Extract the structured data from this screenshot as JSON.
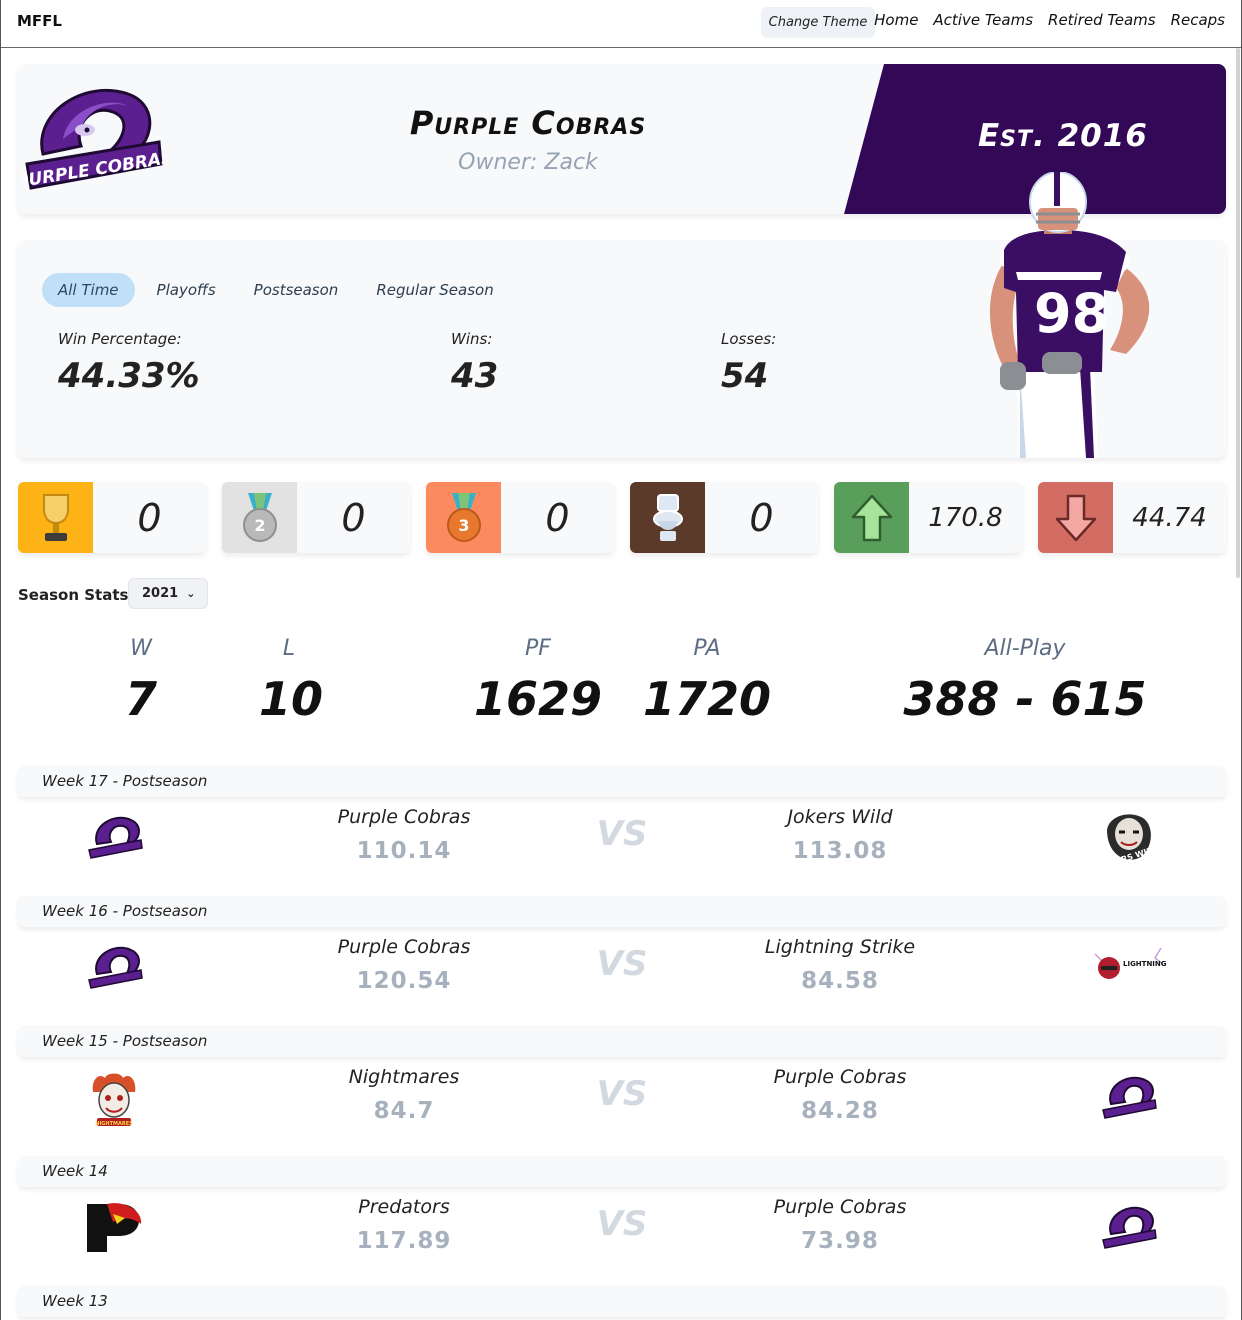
{
  "nav": {
    "brand": "MFFL",
    "theme_button": "Change Theme",
    "links": [
      "Home",
      "Active Teams",
      "Retired Teams",
      "Recaps"
    ]
  },
  "team": {
    "name": "Purple Cobras",
    "owner": "Owner: Zack",
    "established": "Est. 2016",
    "logo_text": "PURPLE COBRAS",
    "primary_color": "#330856",
    "jersey_number": "98"
  },
  "record_tabs": [
    "All Time",
    "Playoffs",
    "Postseason",
    "Regular Season"
  ],
  "record": {
    "win_pct_label": "Win Percentage:",
    "win_pct": "44.33%",
    "wins_label": "Wins:",
    "wins": "43",
    "losses_label": "Losses:",
    "losses": "54"
  },
  "awards": [
    {
      "icon": "trophy-icon",
      "value": "0",
      "color": "#fdb216"
    },
    {
      "icon": "silver-medal-icon",
      "value": "0",
      "color": "#e2e2e2"
    },
    {
      "icon": "bronze-medal-icon",
      "value": "0",
      "color": "#fb8a5e"
    },
    {
      "icon": "toilet-icon",
      "value": "0",
      "color": "#5b3a2a"
    },
    {
      "icon": "arrow-up-icon",
      "value": "170.8",
      "color": "#5a9e5b"
    },
    {
      "icon": "arrow-down-icon",
      "value": "44.74",
      "color": "#d36d63"
    }
  ],
  "season": {
    "label": "Season Stats:",
    "selected": "2021",
    "headers": {
      "w": "W",
      "l": "L",
      "pf": "PF",
      "pa": "PA",
      "allplay": "All-Play"
    },
    "values": {
      "w": "7",
      "l": "10",
      "pf": "1629",
      "pa": "1720",
      "allplay": "388 - 615"
    }
  },
  "vs_text": "VS",
  "games": [
    {
      "week": "Week 17 - Postseason",
      "left": {
        "name": "Purple Cobras",
        "score": "110.14",
        "logo": "cobra-logo-icon"
      },
      "right": {
        "name": "Jokers Wild",
        "score": "113.08",
        "logo": "joker-logo-icon",
        "logo_text": "JOKERS WILD"
      }
    },
    {
      "week": "Week 16 - Postseason",
      "left": {
        "name": "Purple Cobras",
        "score": "120.54",
        "logo": "cobra-logo-icon"
      },
      "right": {
        "name": "Lightning Strike",
        "score": "84.58",
        "logo": "lightning-logo-icon",
        "logo_text": "LIGHTNING STRIKE"
      }
    },
    {
      "week": "Week 15 - Postseason",
      "left": {
        "name": "Nightmares",
        "score": "84.7",
        "logo": "clown-logo-icon",
        "logo_text": "NIGHTMARES"
      },
      "right": {
        "name": "Purple Cobras",
        "score": "84.28",
        "logo": "cobra-logo-icon"
      }
    },
    {
      "week": "Week 14",
      "left": {
        "name": "Predators",
        "score": "117.89",
        "logo": "predator-logo-icon"
      },
      "right": {
        "name": "Purple Cobras",
        "score": "73.98",
        "logo": "cobra-logo-icon"
      }
    }
  ],
  "next_week": "Week 13"
}
